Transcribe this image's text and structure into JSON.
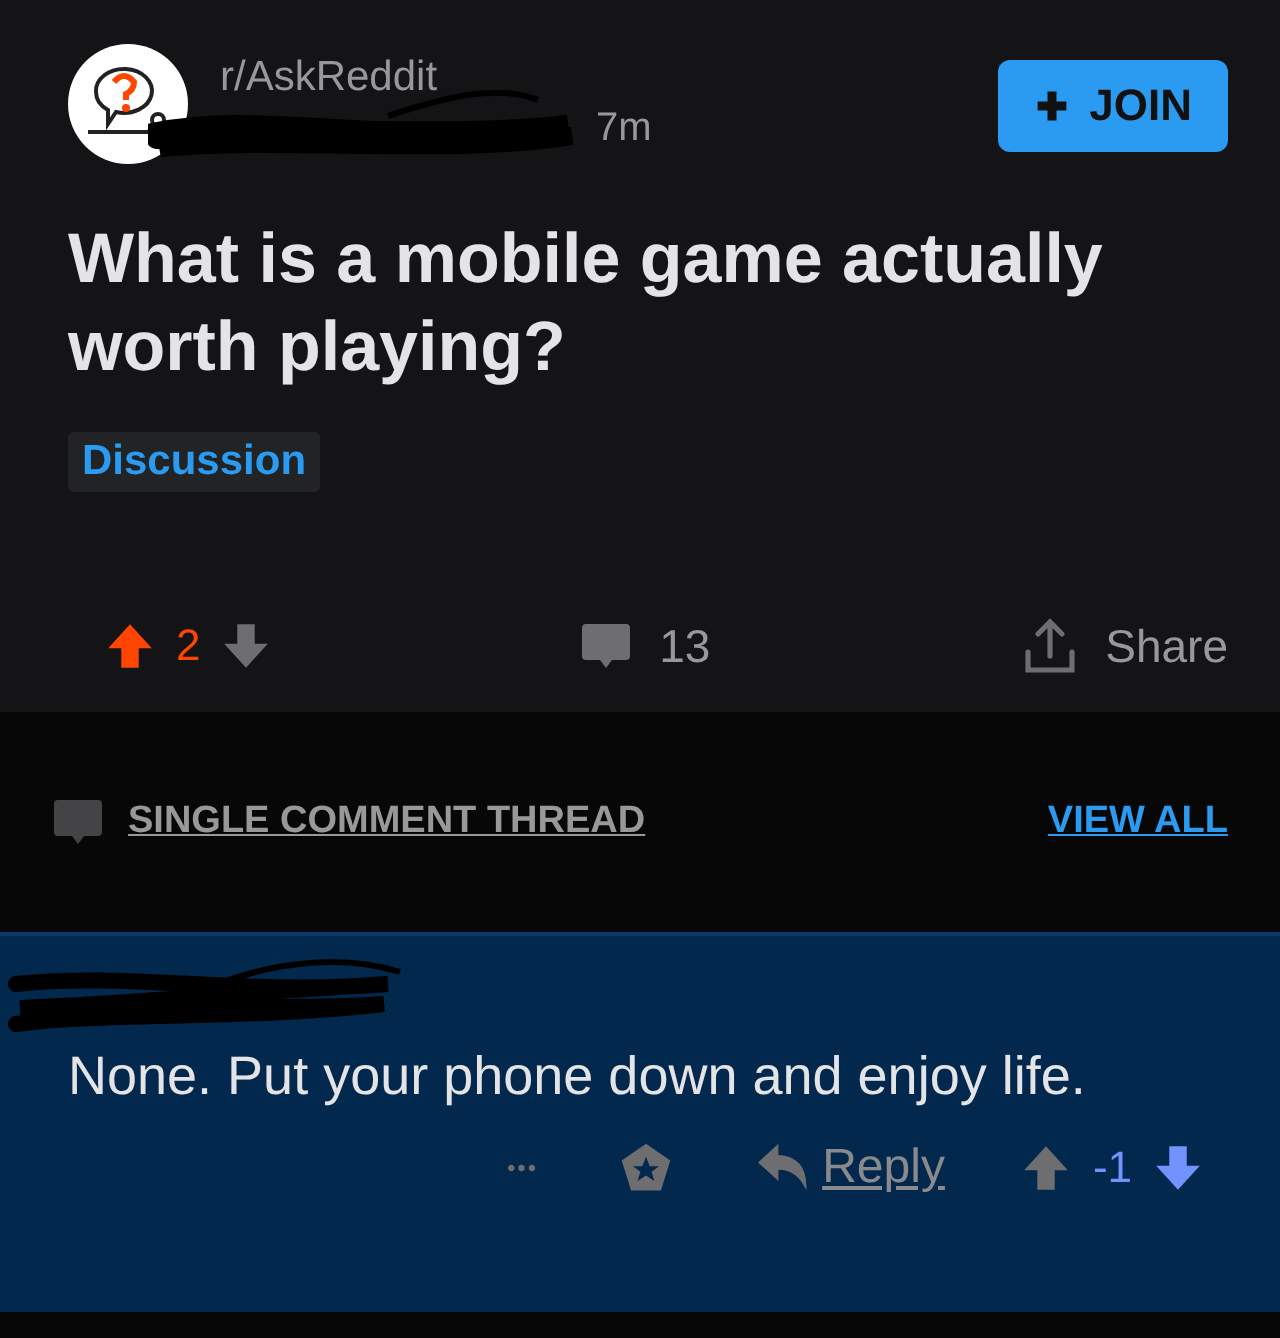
{
  "post": {
    "subreddit": "r/AskReddit",
    "age": "7m",
    "join_button": "JOIN",
    "title": "What is a mobile game actually worth playing?",
    "flair": "Discussion",
    "upvoted": true,
    "downvoted": false,
    "score": "2",
    "comments": "13",
    "share": "Share"
  },
  "thread_bar": {
    "label": "SINGLE COMMENT THREAD",
    "link": "VIEW ALL"
  },
  "comment": {
    "body": "None. Put your phone down and enjoy life.",
    "more": "•••",
    "reply": "Reply",
    "upvoted": false,
    "downvoted": true,
    "score": "-1"
  }
}
